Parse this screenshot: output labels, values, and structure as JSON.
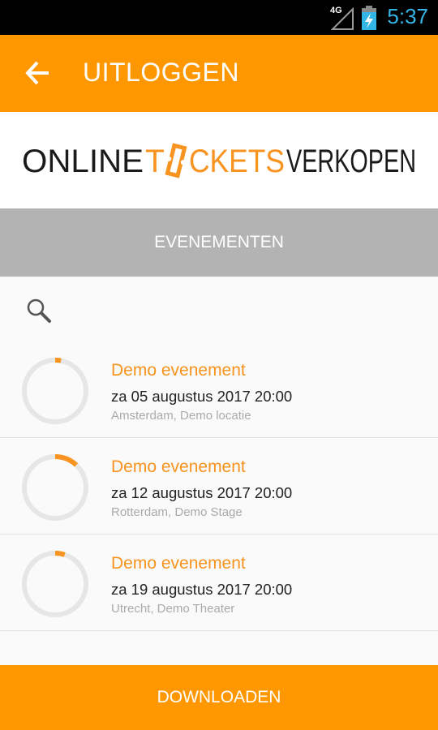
{
  "status_bar": {
    "network_label": "4G",
    "time": "5:37",
    "time_color": "#33b5e5"
  },
  "app_bar": {
    "back_icon": "arrow-left-icon",
    "title": "UITLOGGEN",
    "color": "#ff9800"
  },
  "logo": {
    "text": "ONLINETICKETSVERKOPEN"
  },
  "tabs": [
    {
      "label": "EVENEMENTEN"
    }
  ],
  "search": {
    "icon": "search-icon"
  },
  "events": [
    {
      "title": "Demo evenement",
      "date": "za 05 augustus 2017 20:00",
      "location": "Amsterdam, Demo locatie",
      "progress": 0.03
    },
    {
      "title": "Demo evenement",
      "date": "za 12 augustus 2017 20:00",
      "location": "Rotterdam, Demo Stage",
      "progress": 0.12
    },
    {
      "title": "Demo evenement",
      "date": "za 19 augustus 2017 20:00",
      "location": "Utrecht, Demo Theater",
      "progress": 0.05
    }
  ],
  "bottom_button": {
    "label": "DOWNLOADEN"
  },
  "colors": {
    "accent": "#ff9800",
    "event_title": "#f7931e",
    "tab_bg": "#b3b3b3"
  }
}
